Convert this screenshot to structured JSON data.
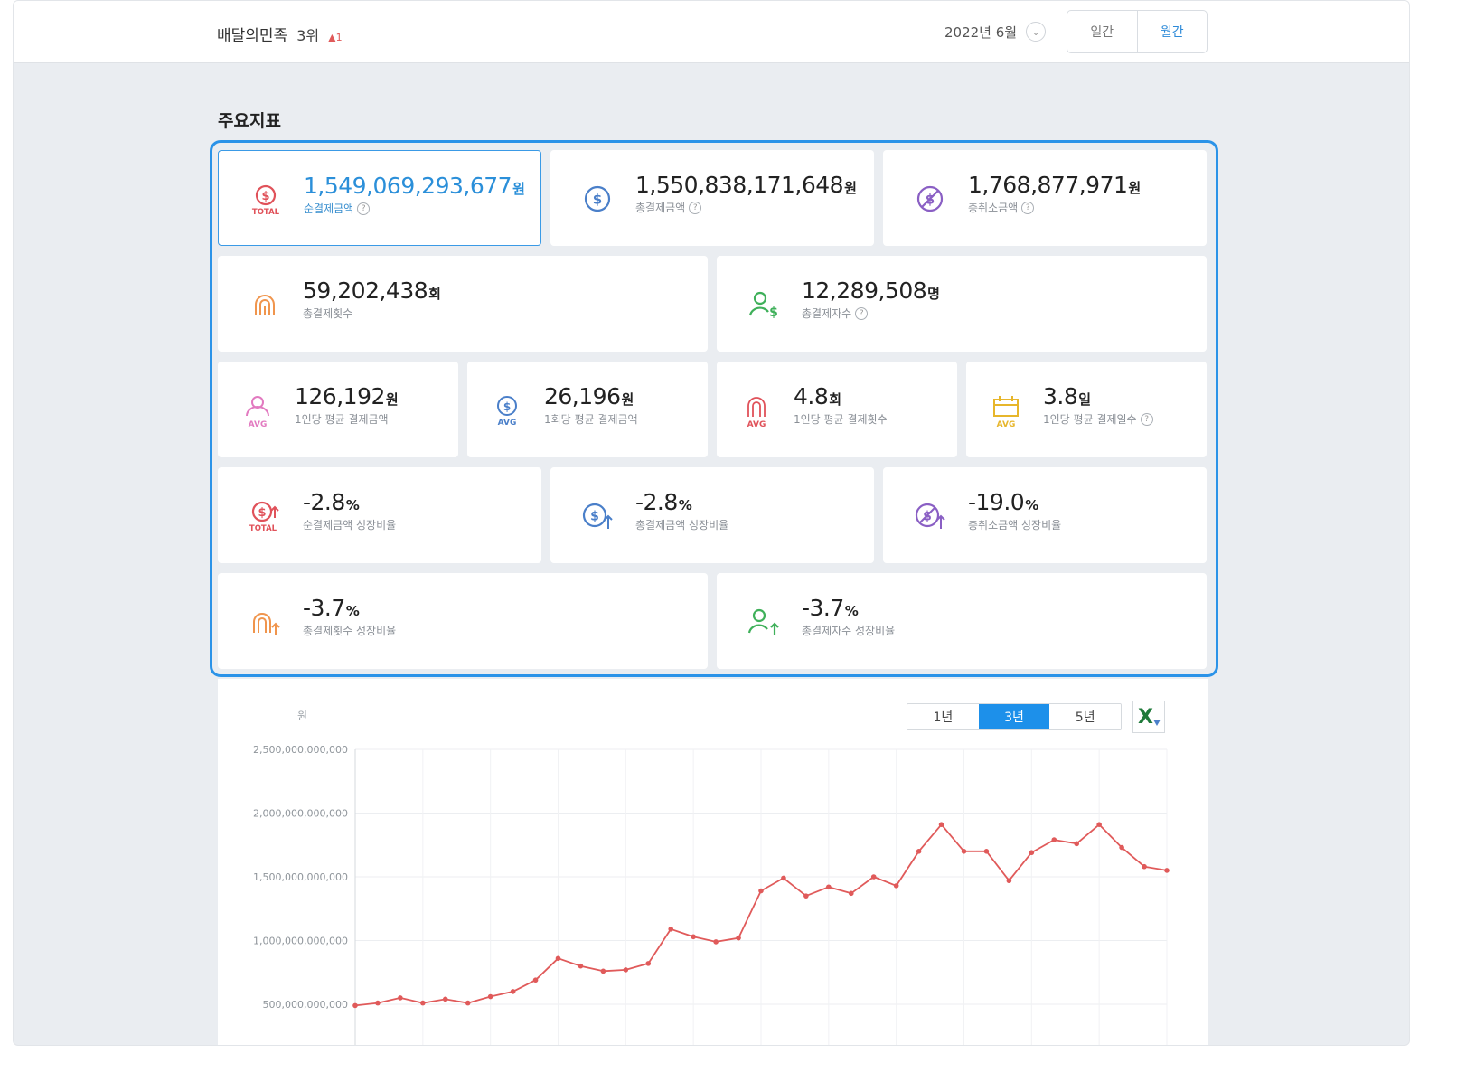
{
  "header": {
    "company": "배달의민족",
    "rank": "3위",
    "rank_change": "▲1",
    "period": "2022년 6월",
    "period_toggle": [
      "일간",
      "월간"
    ],
    "period_selected": "월간"
  },
  "section_title": "주요지표",
  "kpis": [
    {
      "value": "1,549,069,293,677",
      "unit": "원",
      "label": "순결제금액",
      "help": true,
      "icon": "total-dollar-icon",
      "selected": true
    },
    {
      "value": "1,550,838,171,648",
      "unit": "원",
      "label": "총결제금액",
      "help": true,
      "icon": "dollar-circle-icon"
    },
    {
      "value": "1,768,877,971",
      "unit": "원",
      "label": "총취소금액",
      "help": true,
      "icon": "dollar-cancel-icon"
    },
    {
      "value": "59,202,438",
      "unit": "회",
      "label": "총결제횟수",
      "help": false,
      "icon": "fingerprint-icon"
    },
    {
      "value": "12,289,508",
      "unit": "명",
      "label": "총결제자수",
      "help": true,
      "icon": "user-dollar-icon"
    },
    {
      "value": "126,192",
      "unit": "원",
      "label": "1인당 평균 결제금액",
      "help": false,
      "icon": "user-avg-icon"
    },
    {
      "value": "26,196",
      "unit": "원",
      "label": "1회당 평균 결제금액",
      "help": false,
      "icon": "dollar-avg-icon"
    },
    {
      "value": "4.8",
      "unit": "회",
      "label": "1인당 평균 결제횟수",
      "help": false,
      "icon": "fingerprint-avg-icon"
    },
    {
      "value": "3.8",
      "unit": "일",
      "label": "1인당 평균 결제일수",
      "help": true,
      "icon": "calendar-avg-icon"
    },
    {
      "value": "-2.8",
      "unit": "%",
      "label": "순결제금액 성장비율",
      "help": false,
      "icon": "total-dollar-growth-icon"
    },
    {
      "value": "-2.8",
      "unit": "%",
      "label": "총결제금액 성장비율",
      "help": false,
      "icon": "dollar-growth-icon"
    },
    {
      "value": "-19.0",
      "unit": "%",
      "label": "총취소금액 성장비율",
      "help": false,
      "icon": "cancel-growth-icon"
    },
    {
      "value": "-3.7",
      "unit": "%",
      "label": "총결제횟수 성장비율",
      "help": false,
      "icon": "fingerprint-growth-icon"
    },
    {
      "value": "-3.7",
      "unit": "%",
      "label": "총결제자수 성장비율",
      "help": false,
      "icon": "user-growth-icon"
    }
  ],
  "help_glyph": "?",
  "chart_controls": {
    "ranges": [
      "1년",
      "3년",
      "5년"
    ],
    "selected": "3년",
    "excel_glyph": "X"
  },
  "colors": {
    "accent": "#2b93e8",
    "line": "#e05a5a",
    "red": "#e0525a",
    "blue": "#4a7fc9",
    "purple": "#8a5fc4",
    "orange": "#f0954d",
    "green": "#3fb05a",
    "pink": "#e27ac0",
    "yellow": "#e7b62b"
  },
  "chart_data": {
    "type": "line",
    "ylabel": "원",
    "ylim": [
      0,
      2500000000000
    ],
    "yticks": [
      500000000000,
      1000000000000,
      1500000000000,
      2000000000000,
      2500000000000
    ],
    "ytick_labels": [
      "500,000,000,000",
      "1,000,000,000,000",
      "1,500,000,000,000",
      "2,000,000,000,000",
      "2,500,000,000,000"
    ],
    "grid": true,
    "series": [
      {
        "values": [
          490000000000,
          510000000000,
          550000000000,
          510000000000,
          540000000000,
          510000000000,
          560000000000,
          600000000000,
          690000000000,
          860000000000,
          800000000000,
          760000000000,
          770000000000,
          820000000000,
          1090000000000,
          1030000000000,
          990000000000,
          1020000000000,
          1390000000000,
          1490000000000,
          1350000000000,
          1420000000000,
          1370000000000,
          1500000000000,
          1430000000000,
          1700000000000,
          1910000000000,
          1700000000000,
          1700000000000,
          1470000000000,
          1690000000000,
          1790000000000,
          1760000000000,
          1910000000000,
          1730000000000,
          1580000000000,
          1550000000000
        ]
      }
    ]
  }
}
